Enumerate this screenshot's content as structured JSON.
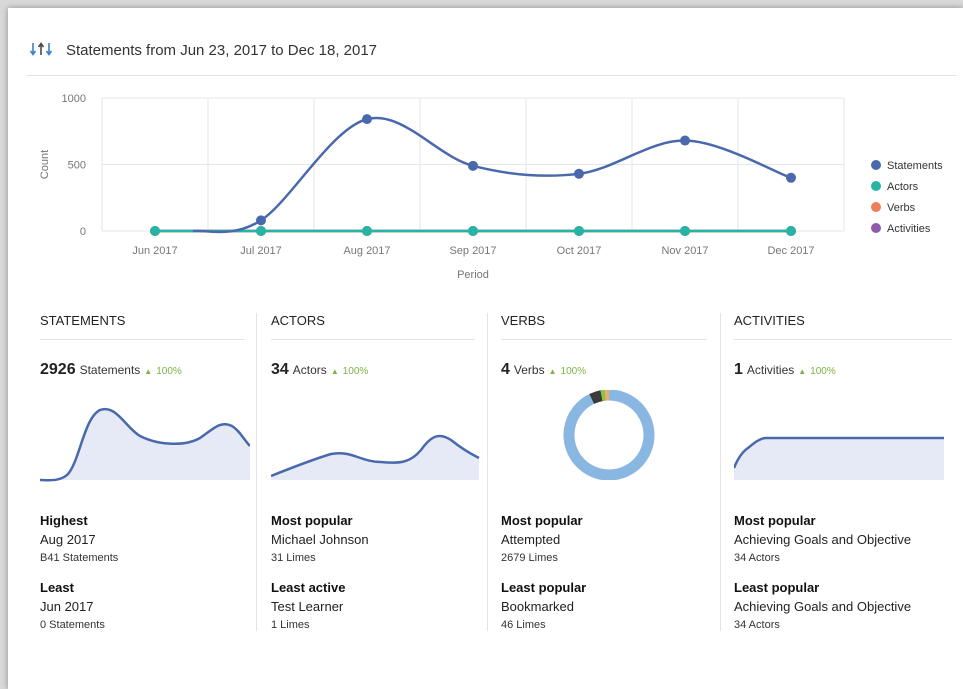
{
  "header": {
    "title": "Statements from Jun 23, 2017 to Dec 18, 2017",
    "icon": "sort-arrows-icon"
  },
  "chart_data": {
    "type": "line",
    "x": [
      "Jun 2017",
      "Jul 2017",
      "Aug 2017",
      "Sep 2017",
      "Oct 2017",
      "Nov 2017",
      "Dec 2017"
    ],
    "ylabel": "Count",
    "xlabel": "Period",
    "ylim": [
      0,
      1000
    ],
    "yticks": [
      0,
      500,
      1000
    ],
    "grid": true,
    "legend": "right",
    "series": [
      {
        "name": "Statements",
        "color": "#4a69ad",
        "values": [
          0,
          80,
          841,
          490,
          430,
          680,
          400
        ]
      },
      {
        "name": "Actors",
        "color": "#26b4a6",
        "values": [
          0,
          0,
          0,
          0,
          0,
          0,
          0
        ]
      },
      {
        "name": "Verbs",
        "color": "#ef7e56",
        "values": [
          0,
          0,
          0,
          0,
          0,
          0,
          0
        ]
      },
      {
        "name": "Activities",
        "color": "#8e5ba8",
        "values": [
          0,
          0,
          0,
          0,
          0,
          0,
          0
        ]
      }
    ]
  },
  "columns": [
    {
      "title": "STATEMENTS",
      "number": "2926",
      "label": "Statements",
      "change": "100%",
      "summary1": {
        "heading": "Highest",
        "value": "Aug 2017",
        "count": "B41 Statements"
      },
      "summary2": {
        "heading": "Least",
        "value": "Jun 2017",
        "count": "0 Statements"
      }
    },
    {
      "title": "ACTORS",
      "number": "34",
      "label": "Actors",
      "change": "100%",
      "summary1": {
        "heading": "Most popular",
        "value": "Michael Johnson",
        "count": "31 Limes"
      },
      "summary2": {
        "heading": "Least active",
        "value": "Test Learner",
        "count": "1 Limes"
      }
    },
    {
      "title": "VERBS",
      "number": "4",
      "label": "Verbs",
      "change": "100%",
      "donut": [
        {
          "value": 2679,
          "color": "#8ab6e2"
        },
        {
          "value": 120,
          "color": "#3a3a3a"
        },
        {
          "value": 46,
          "color": "#8bc34a"
        },
        {
          "value": 40,
          "color": "#f3a96b"
        }
      ],
      "summary1": {
        "heading": "Most popular",
        "value": "Attempted",
        "count": "2679 Limes"
      },
      "summary2": {
        "heading": "Least popular",
        "value": "Bookmarked",
        "count": "46 Limes"
      }
    },
    {
      "title": "ACTIVITIES",
      "number": "1",
      "label": "Activities",
      "change": "100%",
      "summary1": {
        "heading": "Most popular",
        "value": "Achieving Goals and Objective",
        "count": "34 Actors"
      },
      "summary2": {
        "heading": "Least popular",
        "value": "Achieving Goals and Objective",
        "count": "34 Actors"
      }
    }
  ],
  "colors": {
    "accent": "#4a69ad",
    "area": "#e6eaf6",
    "positive": "#7cb342"
  }
}
